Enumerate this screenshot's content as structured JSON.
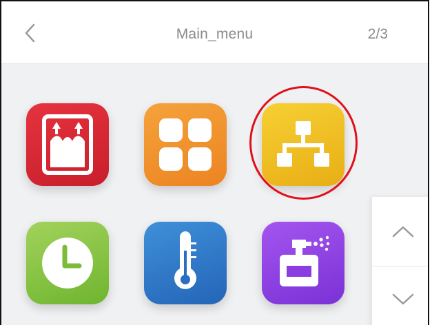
{
  "header": {
    "title": "Main_menu",
    "page_indicator": "2/3",
    "back_icon": "chevron-left-icon"
  },
  "apps": [
    {
      "icon": "elevator-icon",
      "color": "#d92634"
    },
    {
      "icon": "grid-icon",
      "color": "#f0912c"
    },
    {
      "icon": "network-icon",
      "color": "#f0c021",
      "highlighted": true
    },
    {
      "icon": "clock-icon",
      "color": "#86c244"
    },
    {
      "icon": "thermometer-icon",
      "color": "#2f78c8"
    },
    {
      "icon": "fragrance-sprayer-icon",
      "color": "#8f41e3"
    }
  ],
  "scroll": {
    "up_icon": "chevron-up-icon",
    "down_icon": "chevron-down-icon"
  },
  "annotation": {
    "color": "#e0101a"
  }
}
